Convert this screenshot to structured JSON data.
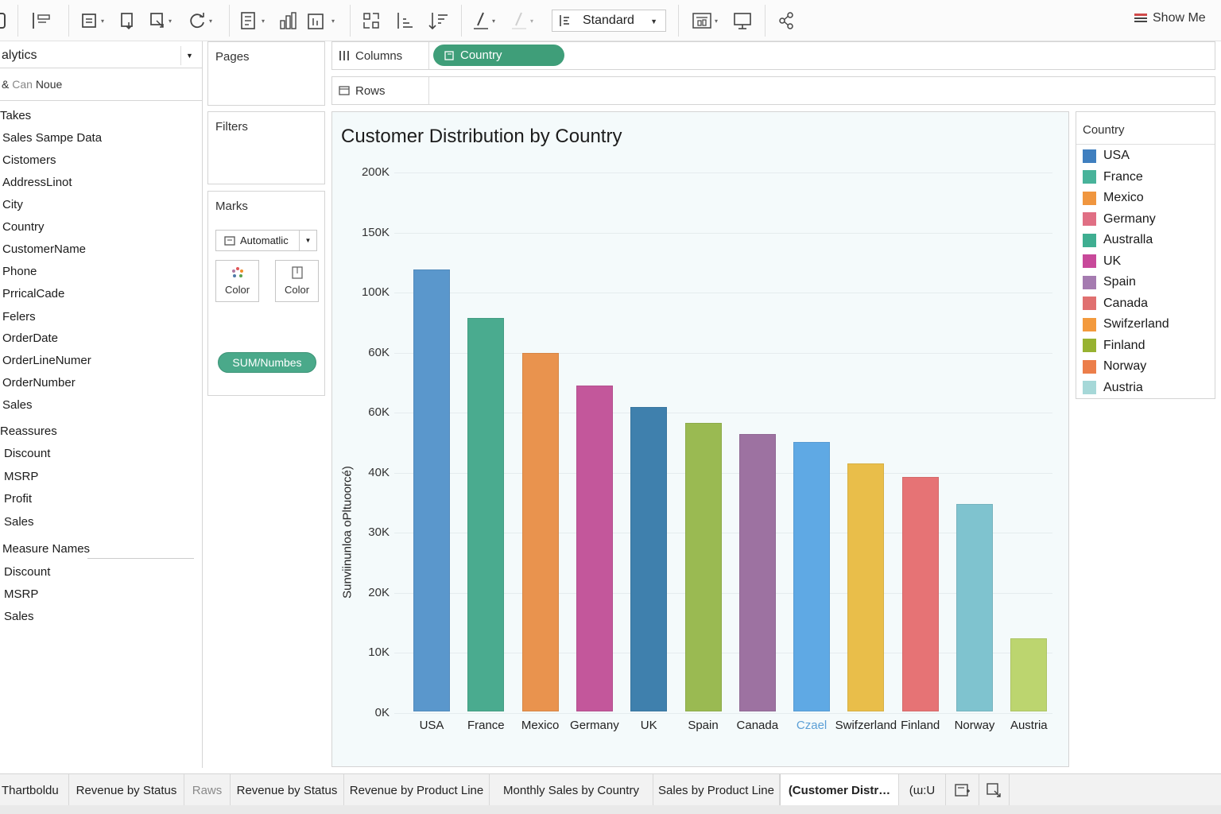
{
  "toolbar": {
    "marks_select": "Standard",
    "show_me": "Show Me",
    "icons": [
      "datasource-icon",
      "swap-icon",
      "new-sheet-icon",
      "duplicate-icon",
      "clear-icon",
      "refresh-icon",
      "group-icon",
      "bars-icon",
      "sort-ascending-icon",
      "sort-descending-icon",
      "sort-icon",
      "highlight-icon",
      "pen-icon",
      "fit-icon",
      "fit-width-icon",
      "presentation-icon",
      "share-icon"
    ]
  },
  "datapane": {
    "header": "alytics",
    "connection_prefix": "&",
    "connection_dim": "Can",
    "connection_name": "Noue",
    "tables_label": "Takes",
    "source": "Sales Sampe Data",
    "fields": [
      "Cistomers",
      "AddressLinot",
      "City",
      "Country",
      "CustomerName",
      "Phone",
      "PrricalCade",
      "Felers",
      "OrderDate",
      "OrderLineNumer",
      "OrderNumber",
      "Sales"
    ],
    "measures_label": "Reassures",
    "measures": [
      "Discount",
      "MSRP",
      "Profit",
      "Sales"
    ],
    "measure_names_label": "Measure Names",
    "measure_names": [
      "Discount",
      "MSRP",
      "Sales"
    ]
  },
  "cards": {
    "pages": "Pages",
    "filters": "Filters",
    "marks": "Marks",
    "marks_type": "Automatlic",
    "color1": "Color",
    "color2": "Color",
    "sum_pill": "SUM/Numbes"
  },
  "shelves": {
    "columns_label": "Columns",
    "columns_pill": "Country",
    "rows_label": "Rows"
  },
  "legend": {
    "title": "Country",
    "items": [
      {
        "label": "USA",
        "color": "#3f7fbf"
      },
      {
        "label": "France",
        "color": "#48b39a"
      },
      {
        "label": "Mexico",
        "color": "#f0963f"
      },
      {
        "label": "Germany",
        "color": "#e06f84"
      },
      {
        "label": "Australla",
        "color": "#3fae91"
      },
      {
        "label": "UK",
        "color": "#c8499a"
      },
      {
        "label": "Spain",
        "color": "#a57bb0"
      },
      {
        "label": "Canada",
        "color": "#e07070"
      },
      {
        "label": "Swifzerland",
        "color": "#f39a3d"
      },
      {
        "label": "Finland",
        "color": "#97b231"
      },
      {
        "label": "Norway",
        "color": "#ec7e4a"
      },
      {
        "label": "Austria",
        "color": "#a6d8d8"
      }
    ]
  },
  "chart_data": {
    "type": "bar",
    "title": "Customer Distribution by Country",
    "ylabel": "Sunviinunloa oPltuoorcé)",
    "xlabel": "",
    "grid": true,
    "yticks": [
      "200K",
      "150K",
      "100K",
      "60K",
      "60K",
      "40K",
      "30K",
      "20K",
      "10K",
      "0K"
    ],
    "categories": [
      "USA",
      "France",
      "Mexico",
      "Germany",
      "UK",
      "Spain",
      "Canada",
      "Czael",
      "Swifzerland",
      "Finland",
      "Norway",
      "Austria"
    ],
    "values": [
      164000,
      146000,
      133000,
      121000,
      113000,
      107000,
      103000,
      100000,
      92000,
      87000,
      77000,
      27000
    ],
    "colors": [
      "#5a97cc",
      "#4aab8f",
      "#e9934e",
      "#c3579b",
      "#3f80ad",
      "#9aba52",
      "#9d72a1",
      "#5fa9e4",
      "#e9be4a",
      "#e67375",
      "#7fc3cf",
      "#bcd56f"
    ],
    "xtick_colors": [
      "#222222",
      "#222222",
      "#222222",
      "#222222",
      "#222222",
      "#222222",
      "#222222",
      "#5b9fd6",
      "#222222",
      "#222222",
      "#222222",
      "#222222"
    ]
  },
  "tabs": [
    {
      "label": "Thartboldu"
    },
    {
      "label": "Revenue by Status"
    },
    {
      "label": "Raws"
    },
    {
      "label": "Revenue by Status"
    },
    {
      "label": "Revenue by Product Line"
    },
    {
      "label": "Monthly Sales by Country"
    },
    {
      "label": "Sales by Product Line"
    },
    {
      "label": "(Customer Distr…"
    },
    {
      "label": "(ɯ:U"
    }
  ]
}
